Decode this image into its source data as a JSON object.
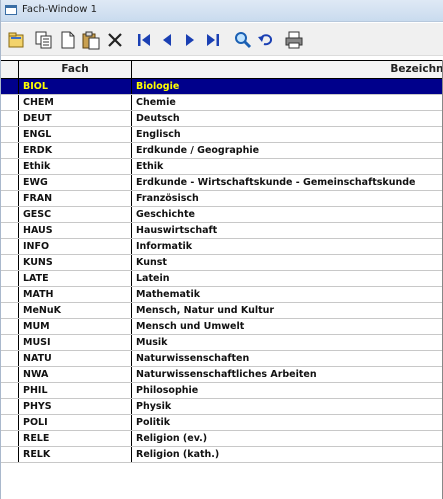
{
  "window": {
    "title": "Fach-Window 1"
  },
  "toolbar": {
    "buttons": [
      {
        "name": "open-record-icon"
      },
      {
        "name": "copy-record-icon"
      },
      {
        "name": "new-record-icon"
      },
      {
        "name": "paste-record-icon"
      },
      {
        "name": "delete-record-icon"
      },
      {
        "name": "first-record-icon"
      },
      {
        "name": "previous-record-icon"
      },
      {
        "name": "next-record-icon"
      },
      {
        "name": "last-record-icon"
      },
      {
        "name": "search-icon"
      },
      {
        "name": "undo-icon"
      },
      {
        "name": "print-icon"
      }
    ]
  },
  "table": {
    "headers": [
      "Fach",
      "Bezeichnung"
    ],
    "active_row": 0,
    "rows": [
      [
        "BIOL",
        "Biologie"
      ],
      [
        "CHEM",
        "Chemie"
      ],
      [
        "DEUT",
        "Deutsch"
      ],
      [
        "ENGL",
        "Englisch"
      ],
      [
        "ERDK",
        "Erdkunde / Geographie"
      ],
      [
        "Ethik",
        "Ethik"
      ],
      [
        "EWG",
        "Erdkunde - Wirtschaftskunde - Gemeinschaftskunde"
      ],
      [
        "FRAN",
        "Französisch"
      ],
      [
        "GESC",
        "Geschichte"
      ],
      [
        "HAUS",
        "Hauswirtschaft"
      ],
      [
        "INFO",
        "Informatik"
      ],
      [
        "KUNS",
        "Kunst"
      ],
      [
        "LATE",
        "Latein"
      ],
      [
        "MATH",
        "Mathematik"
      ],
      [
        "MeNuK",
        "Mensch, Natur und Kultur"
      ],
      [
        "MUM",
        "Mensch und Umwelt"
      ],
      [
        "MUSI",
        "Musik"
      ],
      [
        "NATU",
        "Naturwissenschaften"
      ],
      [
        "NWA",
        "Naturwissenschaftliches Arbeiten"
      ],
      [
        "PHIL",
        "Philosophie"
      ],
      [
        "PHYS",
        "Physik"
      ],
      [
        "POLI",
        "Politik"
      ],
      [
        "RELE",
        "Religion (ev.)"
      ],
      [
        "RELK",
        "Religion (kath.)"
      ]
    ]
  },
  "colors": {
    "selected_row_bg": "#00008b",
    "selected_row_text": "#ffff00"
  }
}
